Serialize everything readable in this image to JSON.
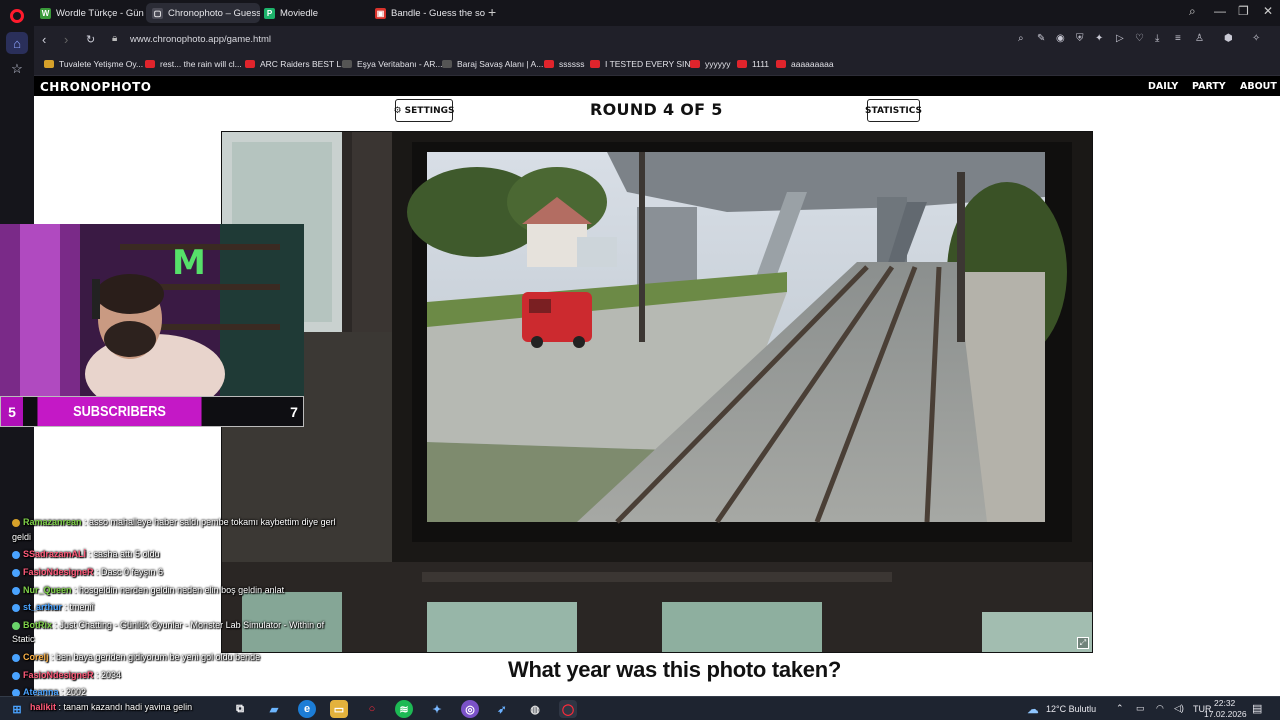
{
  "browser": {
    "tabs": [
      {
        "label": "Wordle Türkçe - Günlük K",
        "favicon": "W",
        "color": "#3a9a3a"
      },
      {
        "label": "Chronophoto – Guess the",
        "favicon": "▢",
        "color": "#4a4a55",
        "active": true
      },
      {
        "label": "Moviedle",
        "favicon": "P",
        "color": "#1db36b"
      },
      {
        "label": "Bandle - Guess the song,",
        "favicon": "▣",
        "color": "#d8332c"
      }
    ],
    "new_tab": "+",
    "url": "www.chronophoto.app/game.html",
    "bookmarks": [
      {
        "label": "Tuvalete Yetişme Oy..."
      },
      {
        "label": "rest... the rain will cl..."
      },
      {
        "label": "ARC Raiders BEST L..."
      },
      {
        "label": "Eşya Veritabanı - AR..."
      },
      {
        "label": "Baraj Savaş Alanı | A..."
      },
      {
        "label": "ssssss"
      },
      {
        "label": "I TESTED EVERY SIN..."
      },
      {
        "label": "yyyyyy"
      },
      {
        "label": "1111"
      },
      {
        "label": "aaaaaaaaa"
      }
    ]
  },
  "site": {
    "logo": "CHRONOPHOTO",
    "nav": {
      "daily": "DAILY",
      "party": "PARTY",
      "about": "ABOUT"
    },
    "settings_label": "SETTINGS",
    "statistics_label": "STATISTICS",
    "round_label": "ROUND 4 OF 5",
    "question": "What year was this photo taken?"
  },
  "stream": {
    "sub_left": "5",
    "sub_label": "SUBSCRIBERS",
    "sub_right": "7",
    "chat": [
      {
        "user": "Ramazanrean",
        "msg": " : asso mahalleye haber saldı pembe tokamı kaybettim diye gerl",
        "color": "#7fd14a"
      },
      {
        "user": "",
        "msg": "geldi",
        "color": "#fff"
      },
      {
        "user": "SSadrazamALİ",
        "msg": " : sasha attı 5 oldu",
        "color": "#ff5a7a"
      },
      {
        "user": "FasioNdesigneR",
        "msg": " : Dasc 0 feyşın 6",
        "color": "#ff5a7a"
      },
      {
        "user": "Nur_Queen",
        "msg": " : hosgeldin nerden geldin neden elin boş geldin anlat",
        "color": "#7fd14a"
      },
      {
        "user": "st_arthur",
        "msg": " : tmeniî",
        "color": "#4aa3ff"
      },
      {
        "user": "BotRix",
        "msg": " : Just Chatting - Günlük Oyunlar - Monster Lab Simulator - Within of",
        "color": "#7fd14a"
      },
      {
        "user": "",
        "msg": "Static",
        "color": "#fff"
      },
      {
        "user": "Corelj",
        "msg": " : ben baya geriden gidiyorum be yeni gol oldu bende",
        "color": "#ffb347"
      },
      {
        "user": "FasioNdesigneR",
        "msg": " : 2034",
        "color": "#ff5a7a"
      },
      {
        "user": "Ateanna",
        "msg": " : 2002",
        "color": "#4aa3ff"
      },
      {
        "user": "halikit",
        "msg": " : tanam kazandı hadi yavina gelin",
        "color": "#ff5a7a"
      }
    ]
  },
  "taskbar": {
    "weather": "12°C Bulutlu",
    "lang": "TUR",
    "time": "22:32",
    "date": "17.02.2026"
  }
}
